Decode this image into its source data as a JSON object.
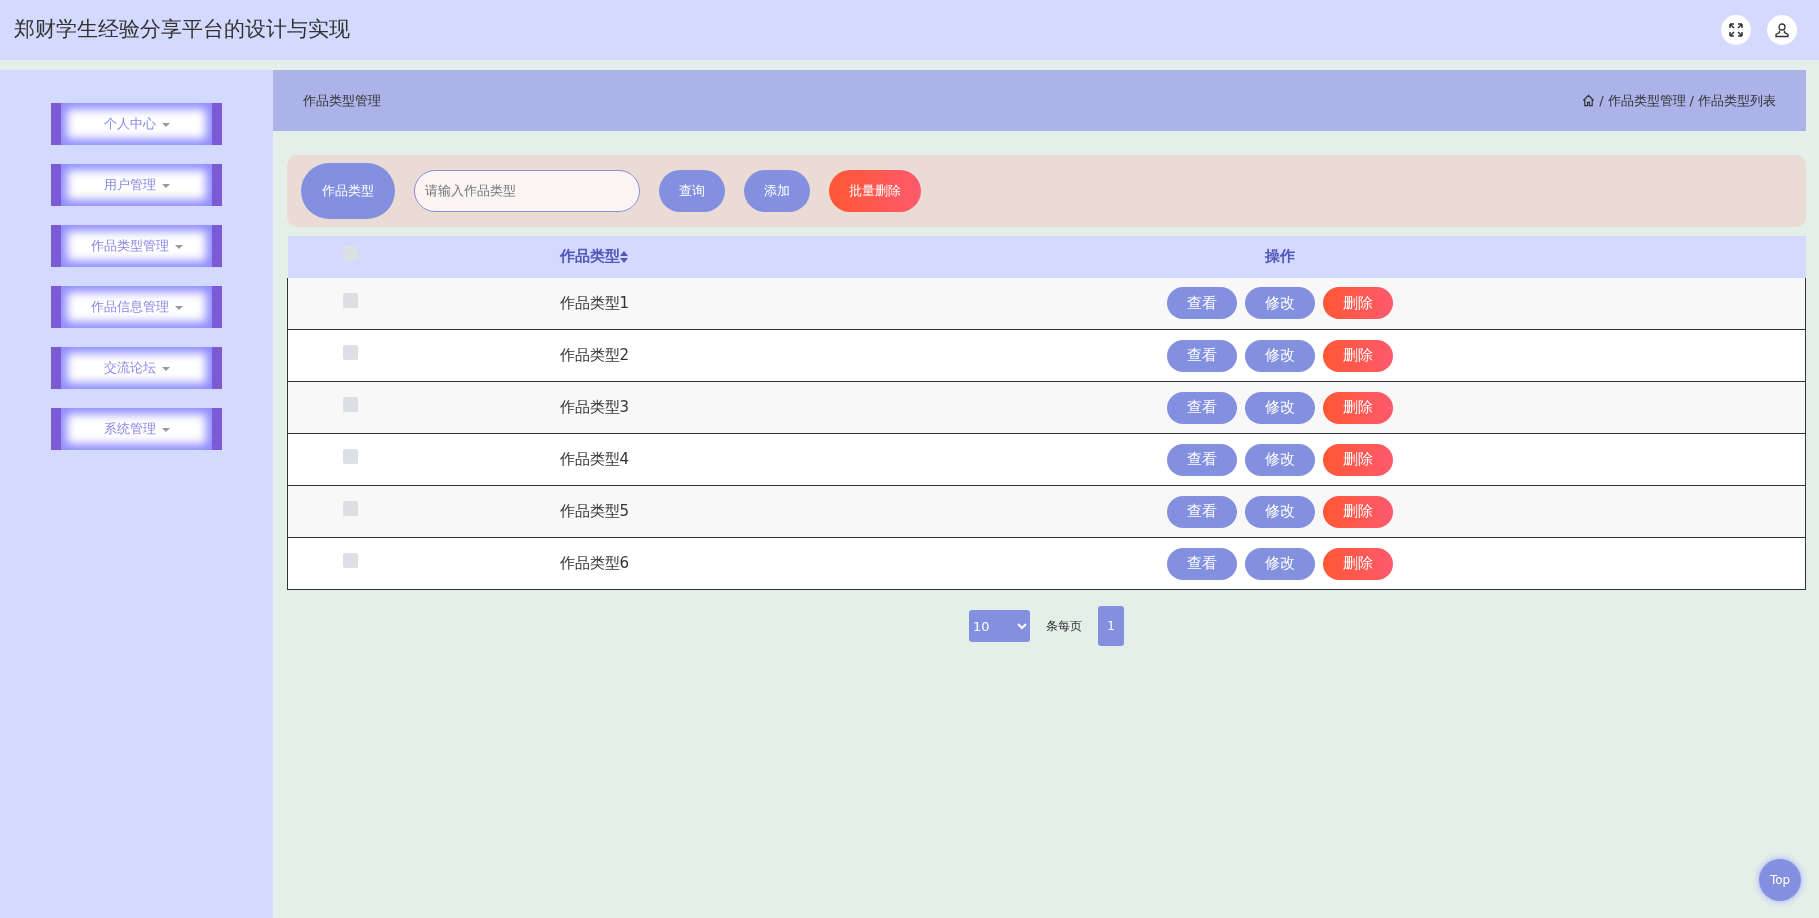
{
  "header": {
    "title": "郑财学生经验分享平台的设计与实现"
  },
  "sidebar": {
    "items": [
      {
        "label": "个人中心"
      },
      {
        "label": "用户管理"
      },
      {
        "label": "作品类型管理"
      },
      {
        "label": "作品信息管理"
      },
      {
        "label": "交流论坛"
      },
      {
        "label": "系统管理"
      }
    ]
  },
  "page_title": "作品类型管理",
  "breadcrumb": [
    "作品类型管理",
    "作品类型列表"
  ],
  "breadcrumb_separator": "/",
  "search": {
    "label": "作品类型",
    "placeholder": "请输入作品类型",
    "buttons": [
      {
        "label": "查询",
        "kind": "primary"
      },
      {
        "label": "添加",
        "kind": "primary"
      },
      {
        "label": "批量删除",
        "kind": "danger"
      }
    ]
  },
  "table": {
    "columns": [
      "作品类型",
      "操作"
    ],
    "header_checked": false,
    "rows": [
      {
        "checked": false,
        "name": "作品类型1",
        "actions": [
          {
            "label": "查看",
            "kind": "primary"
          },
          {
            "label": "修改",
            "kind": "primary"
          },
          {
            "label": "删除",
            "kind": "danger"
          }
        ]
      },
      {
        "checked": false,
        "name": "作品类型2",
        "actions": [
          {
            "label": "查看",
            "kind": "primary"
          },
          {
            "label": "修改",
            "kind": "primary"
          },
          {
            "label": "删除",
            "kind": "danger"
          }
        ]
      },
      {
        "checked": false,
        "name": "作品类型3",
        "actions": [
          {
            "label": "查看",
            "kind": "primary"
          },
          {
            "label": "修改",
            "kind": "primary"
          },
          {
            "label": "删除",
            "kind": "danger"
          }
        ]
      },
      {
        "checked": false,
        "name": "作品类型4",
        "actions": [
          {
            "label": "查看",
            "kind": "primary"
          },
          {
            "label": "修改",
            "kind": "primary"
          },
          {
            "label": "删除",
            "kind": "danger"
          }
        ]
      },
      {
        "checked": false,
        "name": "作品类型5",
        "actions": [
          {
            "label": "查看",
            "kind": "primary"
          },
          {
            "label": "修改",
            "kind": "primary"
          },
          {
            "label": "删除",
            "kind": "danger"
          }
        ]
      },
      {
        "checked": false,
        "name": "作品类型6",
        "actions": [
          {
            "label": "查看",
            "kind": "primary"
          },
          {
            "label": "修改",
            "kind": "primary"
          },
          {
            "label": "删除",
            "kind": "danger"
          }
        ]
      }
    ]
  },
  "pagination": {
    "page_size": "10",
    "per_page_label": "条每页",
    "pages": [
      {
        "label": "1",
        "selected": true
      }
    ]
  },
  "back_to_top": "Top"
}
